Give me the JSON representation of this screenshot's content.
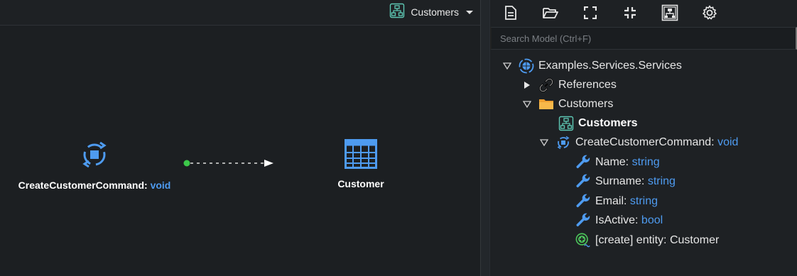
{
  "diagram": {
    "selector_label": "Customers",
    "nodes": {
      "command": {
        "name": "CreateCustomerCommand:",
        "type": "void"
      },
      "entity": {
        "name": "Customer"
      }
    }
  },
  "search": {
    "placeholder": "Search Model (Ctrl+F)"
  },
  "toolbar": {
    "icons": [
      "new-file-icon",
      "open-folder-icon",
      "expand-icon",
      "collapse-icon",
      "diagram-view-icon",
      "settings-icon"
    ]
  },
  "tree": {
    "root": "Examples.Services.Services",
    "references": "References",
    "folder": "Customers",
    "diagram": "Customers",
    "command": {
      "name": "CreateCustomerCommand:",
      "type": "void"
    },
    "fields": [
      {
        "name": "Name:",
        "type": "string"
      },
      {
        "name": "Surname:",
        "type": "string"
      },
      {
        "name": "Email:",
        "type": "string"
      },
      {
        "name": "IsActive:",
        "type": "bool"
      }
    ],
    "action": "[create] entity: Customer"
  },
  "colors": {
    "accent_blue": "#4e9bf0",
    "icon_teal": "#5ec8b4",
    "folder_orange": "#f0a030",
    "connector_green": "#3cc84a",
    "action_green": "#4bc25a"
  }
}
